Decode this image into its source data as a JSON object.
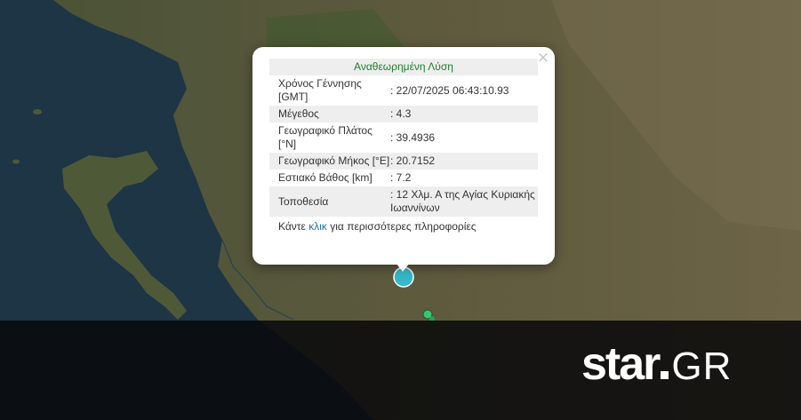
{
  "map": {
    "sea_color": "#1d3545",
    "land_color": "#5a5a3c",
    "epicenter_color": "#35b8c9",
    "minor_marker_color": "#3cc46a"
  },
  "popup": {
    "title": "Αναθεωρημένη Λύση",
    "close_symbol": "×",
    "rows": [
      {
        "label": "Χρόνος Γέννησης [GMT]",
        "value": ": 22/07/2025 06:43:10.93"
      },
      {
        "label": "Μέγεθος",
        "value": ": 4.3"
      },
      {
        "label": "Γεωγραφικό Πλάτος [°N]",
        "value": ": 39.4936"
      },
      {
        "label": "Γεωγραφικό Μήκος [°E]",
        "value": ": 20.7152"
      },
      {
        "label": "Εστιακό Βάθος [km]",
        "value": ": 7.2"
      },
      {
        "label": "Τοποθεσία",
        "value": ": 12 Χλμ. Α της Αγίας Κυριακής Ιωαννίνων"
      }
    ],
    "more_prefix": "Κάντε",
    "more_link": "κλικ",
    "more_suffix": "για περισσότερες πληροφορίες"
  },
  "logo": {
    "main": "star",
    "suffix": "GR"
  }
}
